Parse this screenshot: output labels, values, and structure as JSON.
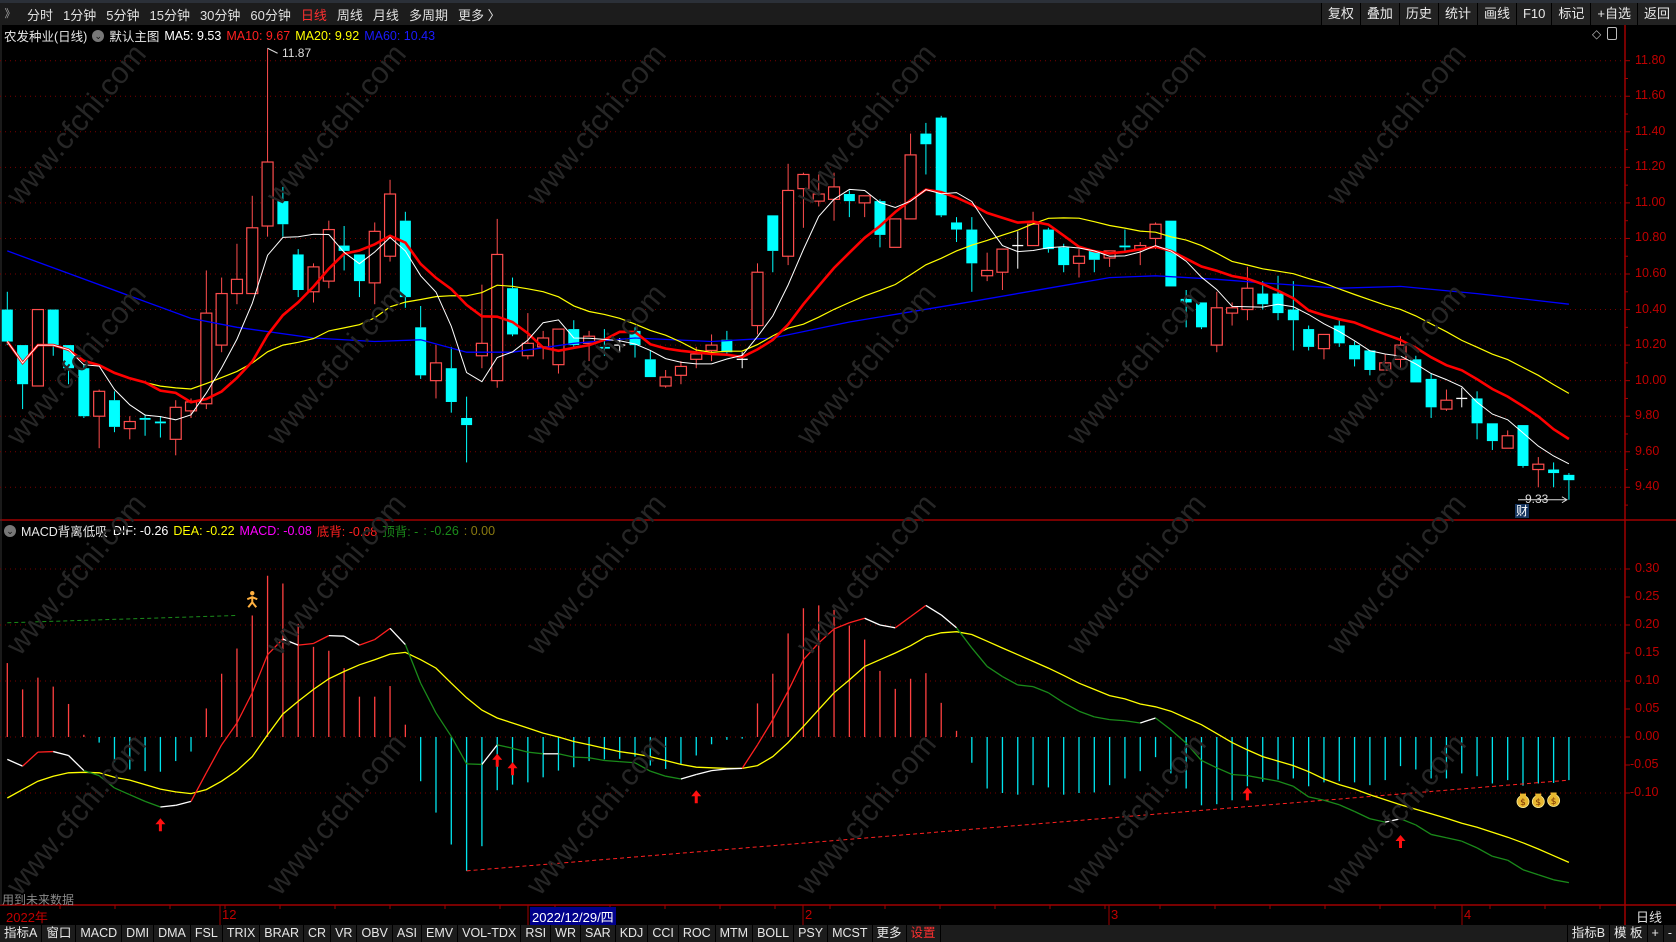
{
  "toolbar": {
    "periods": [
      "分时",
      "1分钟",
      "5分钟",
      "15分钟",
      "30分钟",
      "60分钟",
      "日线",
      "周线",
      "月线",
      "多周期",
      "更多 〉"
    ],
    "active_period": "日线",
    "right_buttons": [
      "复权",
      "叠加",
      "历史",
      "统计",
      "画线",
      "F10",
      "标记",
      "+自选",
      "返回"
    ]
  },
  "info": {
    "title": "农发种业(日线)",
    "template": "默认主图",
    "ma5": "MA5: 9.53",
    "ma10": "MA10: 9.67",
    "ma20": "MA20: 9.92",
    "ma60": "MA60: 10.43"
  },
  "annotations": {
    "high": "11.87",
    "low": "9.33",
    "cai": "财",
    "future": "用到未来数据"
  },
  "macd_header": {
    "name": "MACD背离低吸",
    "dif": "DIF: -0.26",
    "dea": "DEA: -0.22",
    "macd": "MACD: -0.08",
    "bottom_div": "底背: -0.08",
    "top_div": "顶背: -",
    "v1": ": -0.26",
    "v2": ": 0.00"
  },
  "price_axis": [
    "11.80",
    "11.60",
    "11.40",
    "11.20",
    "11.00",
    "10.80",
    "10.60",
    "10.40",
    "10.20",
    "10.00",
    "9.80",
    "9.60",
    "9.40"
  ],
  "macd_axis": [
    "0.30",
    "0.25",
    "0.20",
    "0.15",
    "0.10",
    "0.05",
    "0.00",
    "-0.05",
    "-0.10"
  ],
  "date_axis": {
    "year": "2022年",
    "m12": "12",
    "selected": "2022/12/29/四",
    "m2": "2",
    "m3": "3",
    "m4": "4",
    "period": "日线"
  },
  "bottom_tabs": [
    "指标A",
    "窗口",
    "MACD",
    "DMI",
    "DMA",
    "FSL",
    "TRIX",
    "BRAR",
    "CR",
    "VR",
    "OBV",
    "ASI",
    "EMV",
    "VOL-TDX",
    "RSI",
    "WR",
    "SAR",
    "KDJ",
    "CCI",
    "ROC",
    "MTM",
    "BOLL",
    "PSY",
    "MCST",
    "更多",
    "设置"
  ],
  "bottom_right": [
    "指标B",
    "模 板",
    "+",
    "-"
  ],
  "watermark": "www.cfchi.com",
  "colors": {
    "up": "#ff4d4d",
    "down": "#00ffff",
    "ma5": "#ffffff",
    "ma10": "#ff0000",
    "ma20": "#ffff00",
    "ma60": "#0000ff",
    "axis": "#c00000"
  },
  "chart_data": {
    "type": "candlestick",
    "price_range": [
      9.3,
      11.9
    ],
    "candles_ohlc": [
      [
        10.4,
        10.5,
        10.2,
        10.22
      ],
      [
        10.2,
        10.2,
        9.84,
        9.98
      ],
      [
        9.97,
        10.4,
        9.97,
        10.4
      ],
      [
        10.4,
        10.4,
        10.14,
        10.2
      ],
      [
        10.2,
        10.2,
        9.98,
        10.07
      ],
      [
        10.07,
        10.09,
        9.79,
        9.8
      ],
      [
        9.8,
        9.95,
        9.62,
        9.94
      ],
      [
        9.89,
        9.94,
        9.71,
        9.74
      ],
      [
        9.73,
        9.8,
        9.67,
        9.77
      ],
      [
        9.79,
        9.81,
        9.69,
        9.78
      ],
      [
        9.77,
        9.8,
        9.68,
        9.76
      ],
      [
        9.67,
        9.89,
        9.58,
        9.85
      ],
      [
        9.83,
        9.9,
        9.79,
        9.88
      ],
      [
        9.87,
        10.62,
        9.84,
        10.38
      ],
      [
        10.2,
        10.58,
        10.16,
        10.49
      ],
      [
        10.49,
        10.77,
        10.43,
        10.57
      ],
      [
        10.49,
        11.04,
        10.49,
        10.86
      ],
      [
        10.87,
        11.87,
        10.81,
        11.23
      ],
      [
        11.01,
        11.09,
        10.81,
        10.88
      ],
      [
        10.71,
        10.74,
        10.47,
        10.51
      ],
      [
        10.5,
        10.66,
        10.44,
        10.64
      ],
      [
        10.56,
        10.9,
        10.52,
        10.85
      ],
      [
        10.76,
        10.87,
        10.62,
        10.73
      ],
      [
        10.71,
        10.71,
        10.47,
        10.56
      ],
      [
        10.55,
        10.89,
        10.43,
        10.84
      ],
      [
        10.7,
        11.13,
        10.67,
        11.05
      ],
      [
        10.9,
        10.95,
        10.41,
        10.47
      ],
      [
        10.3,
        10.42,
        10.01,
        10.03
      ],
      [
        10.0,
        10.2,
        9.9,
        10.1
      ],
      [
        10.07,
        10.19,
        9.82,
        9.88
      ],
      [
        9.79,
        9.91,
        9.54,
        9.75
      ],
      [
        10.14,
        10.54,
        10.07,
        10.21
      ],
      [
        10.0,
        10.91,
        9.96,
        10.71
      ],
      [
        10.52,
        10.58,
        10.25,
        10.26
      ],
      [
        10.14,
        10.38,
        10.12,
        10.21
      ],
      [
        10.19,
        10.28,
        10.12,
        10.24
      ],
      [
        10.09,
        10.29,
        10.04,
        10.29
      ],
      [
        10.29,
        10.34,
        10.19,
        10.2
      ],
      [
        10.21,
        10.28,
        10.11,
        10.25
      ],
      [
        10.19,
        10.29,
        10.14,
        10.18
      ],
      [
        10.2,
        10.24,
        10.16,
        10.2
      ],
      [
        10.28,
        10.3,
        10.13,
        10.2
      ],
      [
        10.12,
        10.17,
        10.02,
        10.02
      ],
      [
        9.97,
        10.06,
        9.96,
        10.02
      ],
      [
        10.03,
        10.11,
        9.98,
        10.08
      ],
      [
        10.12,
        10.19,
        10.07,
        10.15
      ],
      [
        10.17,
        10.26,
        10.11,
        10.2
      ],
      [
        10.23,
        10.28,
        10.15,
        10.16
      ],
      [
        10.12,
        10.16,
        10.07,
        10.12
      ],
      [
        10.31,
        10.66,
        10.26,
        10.61
      ],
      [
        10.93,
        10.93,
        10.61,
        10.73
      ],
      [
        10.7,
        11.22,
        10.65,
        11.07
      ],
      [
        11.08,
        11.17,
        10.86,
        11.16
      ],
      [
        11.01,
        11.16,
        10.98,
        11.05
      ],
      [
        11.02,
        11.17,
        10.9,
        11.09
      ],
      [
        11.05,
        11.07,
        10.92,
        11.01
      ],
      [
        11.0,
        11.04,
        10.92,
        11.04
      ],
      [
        11.01,
        11.02,
        10.75,
        10.82
      ],
      [
        10.75,
        10.91,
        10.75,
        10.91
      ],
      [
        10.91,
        11.39,
        10.91,
        11.27
      ],
      [
        11.39,
        11.45,
        11.16,
        11.33
      ],
      [
        11.48,
        11.49,
        10.92,
        10.93
      ],
      [
        10.89,
        10.92,
        10.78,
        10.85
      ],
      [
        10.85,
        10.92,
        10.5,
        10.66
      ],
      [
        10.59,
        10.72,
        10.56,
        10.62
      ],
      [
        10.61,
        10.74,
        10.51,
        10.74
      ],
      [
        10.76,
        10.84,
        10.63,
        10.76
      ],
      [
        10.76,
        10.95,
        10.76,
        10.88
      ],
      [
        10.85,
        10.86,
        10.72,
        10.74
      ],
      [
        10.75,
        10.77,
        10.61,
        10.65
      ],
      [
        10.66,
        10.74,
        10.58,
        10.7
      ],
      [
        10.73,
        10.73,
        10.61,
        10.68
      ],
      [
        10.69,
        10.73,
        10.64,
        10.73
      ],
      [
        10.76,
        10.85,
        10.73,
        10.75
      ],
      [
        10.74,
        10.78,
        10.65,
        10.76
      ],
      [
        10.8,
        10.89,
        10.74,
        10.88
      ],
      [
        10.9,
        10.9,
        10.53,
        10.53
      ],
      [
        10.46,
        10.51,
        10.3,
        10.44
      ],
      [
        10.44,
        10.44,
        10.29,
        10.3
      ],
      [
        10.2,
        10.5,
        10.16,
        10.41
      ],
      [
        10.38,
        10.44,
        10.31,
        10.41
      ],
      [
        10.4,
        10.64,
        10.34,
        10.52
      ],
      [
        10.49,
        10.56,
        10.4,
        10.43
      ],
      [
        10.49,
        10.59,
        10.34,
        10.38
      ],
      [
        10.4,
        10.56,
        10.17,
        10.34
      ],
      [
        10.29,
        10.31,
        10.17,
        10.19
      ],
      [
        10.18,
        10.26,
        10.12,
        10.26
      ],
      [
        10.31,
        10.34,
        10.19,
        10.21
      ],
      [
        10.2,
        10.22,
        10.08,
        10.12
      ],
      [
        10.17,
        10.17,
        10.03,
        10.06
      ],
      [
        10.06,
        10.15,
        10.06,
        10.1
      ],
      [
        10.12,
        10.25,
        10.07,
        10.2
      ],
      [
        10.12,
        10.14,
        9.99,
        9.99
      ],
      [
        10.01,
        10.04,
        9.79,
        9.85
      ],
      [
        9.84,
        9.95,
        9.83,
        9.89
      ],
      [
        9.9,
        9.96,
        9.85,
        9.9
      ],
      [
        9.9,
        9.94,
        9.67,
        9.76
      ],
      [
        9.76,
        9.76,
        9.61,
        9.66
      ],
      [
        9.62,
        9.72,
        9.62,
        9.69
      ],
      [
        9.75,
        9.75,
        9.51,
        9.52
      ],
      [
        9.5,
        9.57,
        9.4,
        9.53
      ],
      [
        9.5,
        9.54,
        9.4,
        9.48
      ],
      [
        9.47,
        9.48,
        9.33,
        9.44
      ]
    ],
    "doji_indices": [
      40,
      48,
      66,
      95
    ],
    "ma60_points": [
      [
        0,
        10.73
      ],
      [
        12,
        10.35
      ],
      [
        15,
        10.3
      ],
      [
        20,
        10.24
      ],
      [
        24,
        10.22
      ],
      [
        27,
        10.23
      ],
      [
        30,
        10.16
      ],
      [
        33,
        10.16
      ],
      [
        37,
        10.21
      ],
      [
        41,
        10.24
      ],
      [
        46,
        10.22
      ],
      [
        50,
        10.24
      ],
      [
        55,
        10.33
      ],
      [
        62,
        10.43
      ],
      [
        68,
        10.52
      ],
      [
        72,
        10.58
      ],
      [
        75,
        10.59
      ],
      [
        79,
        10.57
      ],
      [
        82,
        10.55
      ],
      [
        87,
        10.52
      ],
      [
        91,
        10.53
      ],
      [
        96,
        10.49
      ],
      [
        102,
        10.43
      ]
    ],
    "macd": {
      "range": [
        -0.3,
        0.33
      ],
      "hist": [
        0.132,
        0.085,
        0.106,
        0.09,
        0.059,
        0.004,
        -0.01,
        -0.045,
        -0.058,
        -0.061,
        -0.062,
        -0.043,
        -0.026,
        0.051,
        0.113,
        0.158,
        0.217,
        0.288,
        0.274,
        0.202,
        0.161,
        0.154,
        0.123,
        0.072,
        0.072,
        0.091,
        0.022,
        -0.079,
        -0.135,
        -0.192,
        -0.239,
        -0.195,
        -0.095,
        -0.085,
        -0.081,
        -0.072,
        -0.06,
        -0.054,
        -0.043,
        -0.04,
        -0.039,
        -0.035,
        -0.051,
        -0.057,
        -0.049,
        -0.033,
        -0.013,
        -0.005,
        -0.003,
        0.06,
        0.113,
        0.185,
        0.23,
        0.235,
        0.227,
        0.199,
        0.174,
        0.118,
        0.086,
        0.104,
        0.114,
        0.061,
        0.011,
        -0.046,
        -0.092,
        -0.1,
        -0.103,
        -0.086,
        -0.09,
        -0.103,
        -0.1,
        -0.099,
        -0.086,
        -0.074,
        -0.061,
        -0.036,
        -0.065,
        -0.092,
        -0.122,
        -0.12,
        -0.113,
        -0.088,
        -0.08,
        -0.076,
        -0.074,
        -0.088,
        -0.081,
        -0.079,
        -0.081,
        -0.086,
        -0.077,
        -0.052,
        -0.058,
        -0.074,
        -0.074,
        -0.065,
        -0.07,
        -0.083,
        -0.077,
        -0.087,
        -0.083,
        -0.082,
        -0.077
      ],
      "dif": [
        -0.04,
        -0.052,
        -0.027,
        -0.026,
        -0.033,
        -0.06,
        -0.069,
        -0.091,
        -0.103,
        -0.115,
        -0.125,
        -0.122,
        -0.115,
        -0.064,
        -0.014,
        0.025,
        0.079,
        0.147,
        0.175,
        0.164,
        0.167,
        0.181,
        0.18,
        0.164,
        0.174,
        0.194,
        0.165,
        0.096,
        0.043,
        0.001,
        -0.048,
        -0.049,
        -0.014,
        -0.02,
        -0.027,
        -0.03,
        -0.03,
        -0.036,
        -0.037,
        -0.042,
        -0.044,
        -0.046,
        -0.061,
        -0.07,
        -0.075,
        -0.067,
        -0.06,
        -0.057,
        -0.056,
        -0.014,
        0.031,
        0.082,
        0.138,
        0.168,
        0.193,
        0.204,
        0.212,
        0.2,
        0.195,
        0.215,
        0.235,
        0.218,
        0.195,
        0.159,
        0.126,
        0.108,
        0.093,
        0.09,
        0.079,
        0.061,
        0.046,
        0.036,
        0.031,
        0.029,
        0.025,
        0.034,
        0.013,
        -0.011,
        -0.042,
        -0.055,
        -0.067,
        -0.069,
        -0.074,
        -0.079,
        -0.088,
        -0.107,
        -0.113,
        -0.121,
        -0.133,
        -0.146,
        -0.152,
        -0.146,
        -0.157,
        -0.174,
        -0.18,
        -0.186,
        -0.198,
        -0.213,
        -0.22,
        -0.237,
        -0.246,
        -0.255,
        -0.26
      ],
      "dea": [
        -0.109,
        -0.094,
        -0.079,
        -0.07,
        -0.064,
        -0.063,
        -0.064,
        -0.072,
        -0.077,
        -0.085,
        -0.093,
        -0.098,
        -0.101,
        -0.094,
        -0.079,
        -0.06,
        -0.035,
        0.004,
        0.041,
        0.064,
        0.085,
        0.104,
        0.117,
        0.129,
        0.138,
        0.148,
        0.151,
        0.138,
        0.123,
        0.096,
        0.07,
        0.048,
        0.034,
        0.025,
        0.016,
        0.007,
        0,
        -0.008,
        -0.014,
        -0.02,
        -0.026,
        -0.03,
        -0.035,
        -0.042,
        -0.049,
        -0.054,
        -0.055,
        -0.056,
        -0.056,
        -0.051,
        -0.035,
        -0.01,
        0.019,
        0.049,
        0.079,
        0.102,
        0.126,
        0.138,
        0.15,
        0.163,
        0.179,
        0.186,
        0.188,
        0.183,
        0.171,
        0.159,
        0.147,
        0.135,
        0.123,
        0.11,
        0.096,
        0.085,
        0.074,
        0.068,
        0.059,
        0.054,
        0.046,
        0.034,
        0.022,
        0.006,
        -0.01,
        -0.023,
        -0.035,
        -0.043,
        -0.051,
        -0.062,
        -0.075,
        -0.085,
        -0.093,
        -0.103,
        -0.112,
        -0.121,
        -0.129,
        -0.137,
        -0.145,
        -0.154,
        -0.161,
        -0.17,
        -0.179,
        -0.189,
        -0.2,
        -0.212,
        -0.224
      ],
      "green_dashed": [
        [
          0,
          0.204
        ],
        [
          15,
          0.217
        ]
      ],
      "red_dashed": [
        [
          30,
          -0.239
        ],
        [
          102,
          -0.077
        ]
      ],
      "up_arrows": [
        [
          10,
          -0.145
        ],
        [
          32,
          -0.03
        ],
        [
          33,
          -0.045
        ],
        [
          45,
          -0.095
        ],
        [
          81,
          -0.09
        ],
        [
          91,
          -0.175
        ]
      ],
      "person_marker": [
        16,
        0.246
      ],
      "money_bags": [
        [
          99,
          -0.11
        ],
        [
          100,
          -0.11
        ],
        [
          101,
          -0.108
        ]
      ]
    }
  }
}
